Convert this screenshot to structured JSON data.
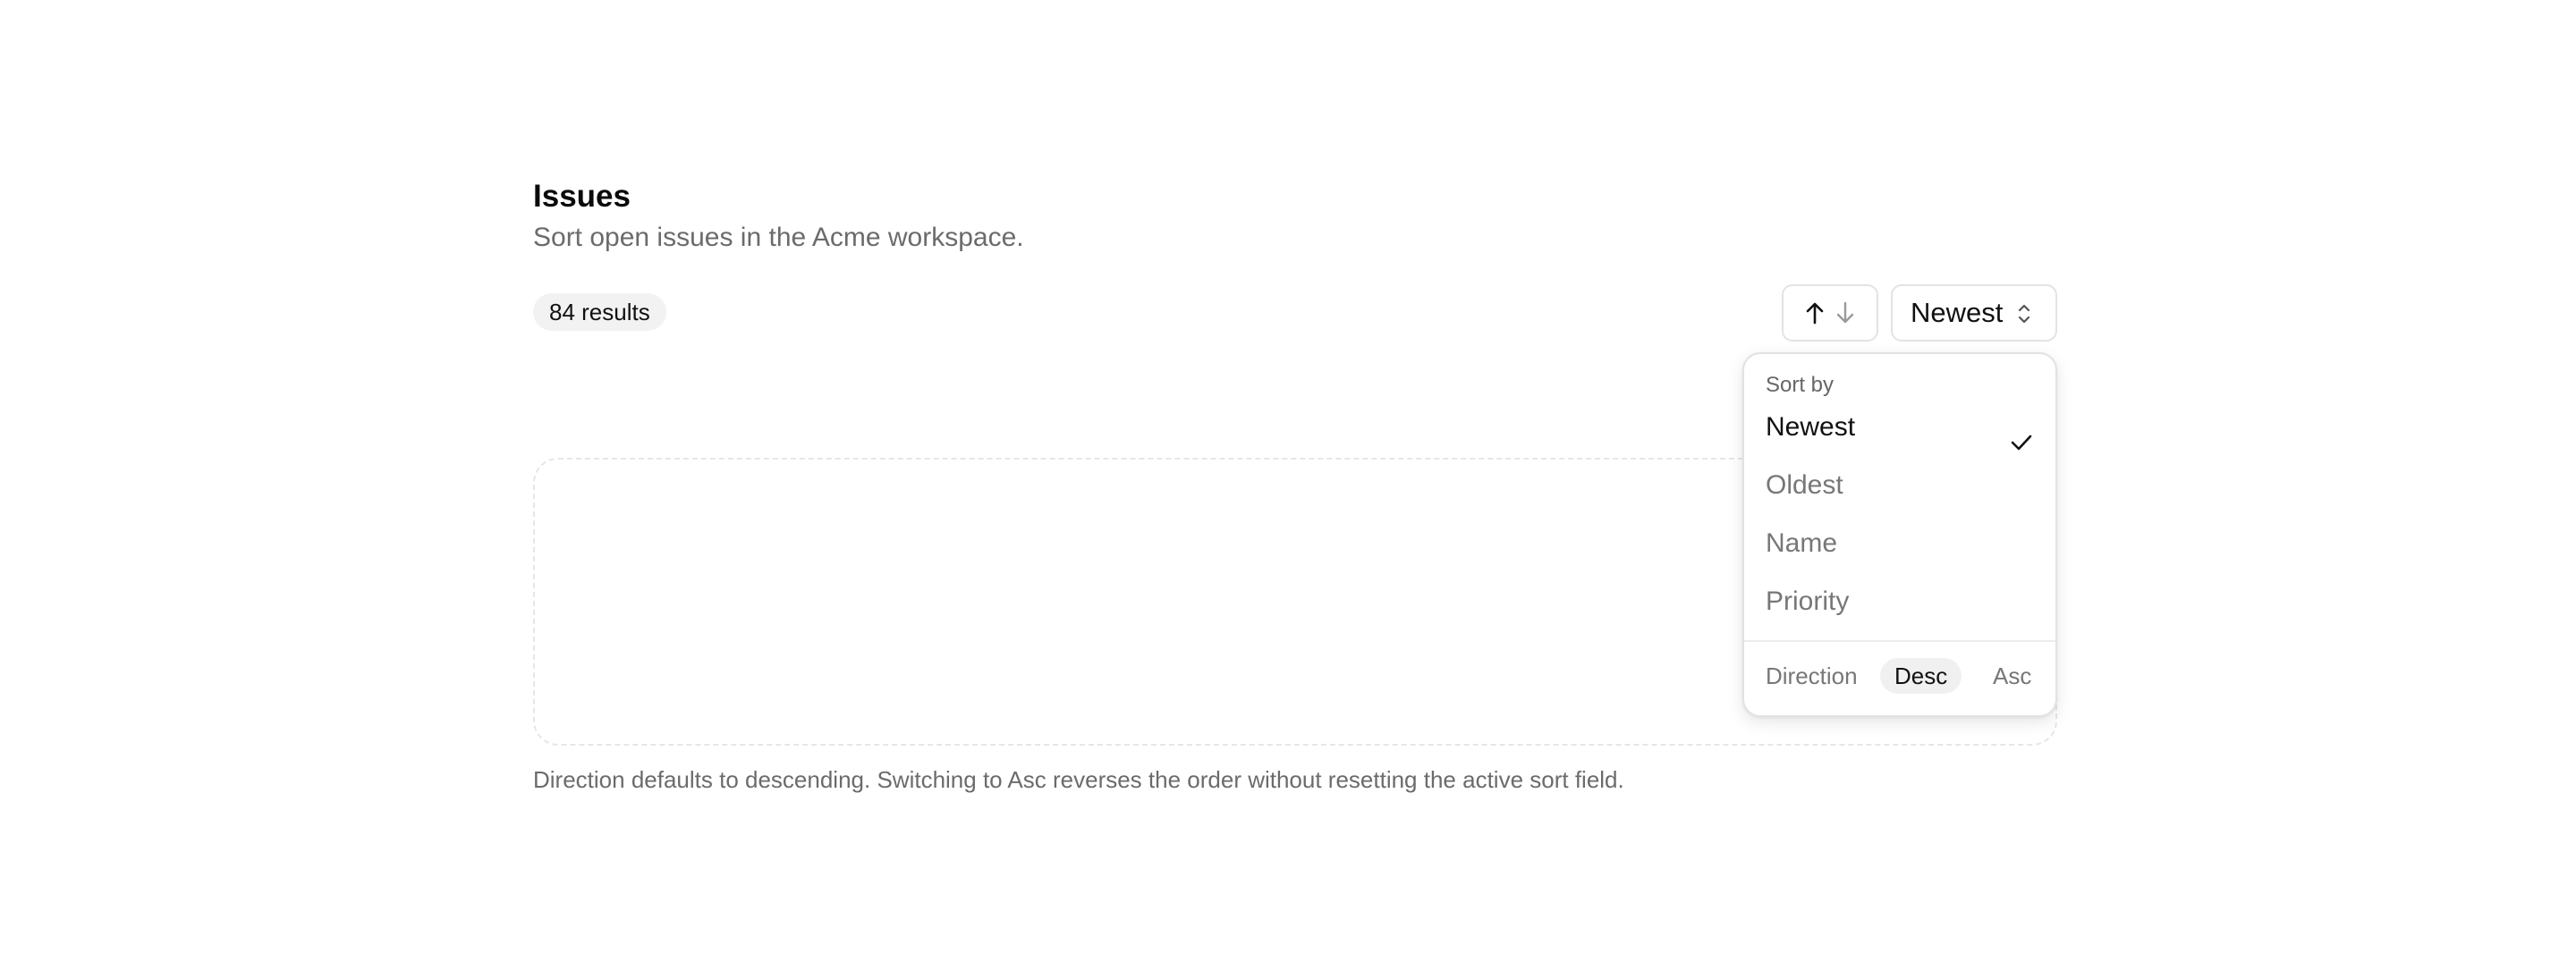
{
  "header": {
    "title": "Issues",
    "subtitle": "Sort open issues in the Acme workspace."
  },
  "toolbar": {
    "results_label": "84 results",
    "direction_toggle_icons": [
      "arrow-up-icon",
      "arrow-down-icon"
    ],
    "sort_select_value": "Newest",
    "sort_select_icon": "chevron-up-down-icon"
  },
  "sort_menu": {
    "header": "Sort by",
    "items": [
      {
        "label": "Newest",
        "selected": true
      },
      {
        "label": "Oldest",
        "selected": false
      },
      {
        "label": "Name",
        "selected": false
      },
      {
        "label": "Priority",
        "selected": false
      }
    ],
    "direction": {
      "label": "Direction",
      "options": [
        "Desc",
        "Asc"
      ],
      "selected": "Desc"
    }
  },
  "footnote": "Direction defaults to descending. Switching to Asc reverses the order without resetting the active sort field.",
  "colors": {
    "text_primary": "#111111",
    "text_muted": "#6b6b6b",
    "border": "#e3e3e3",
    "badge_bg": "#f2f2f2"
  }
}
